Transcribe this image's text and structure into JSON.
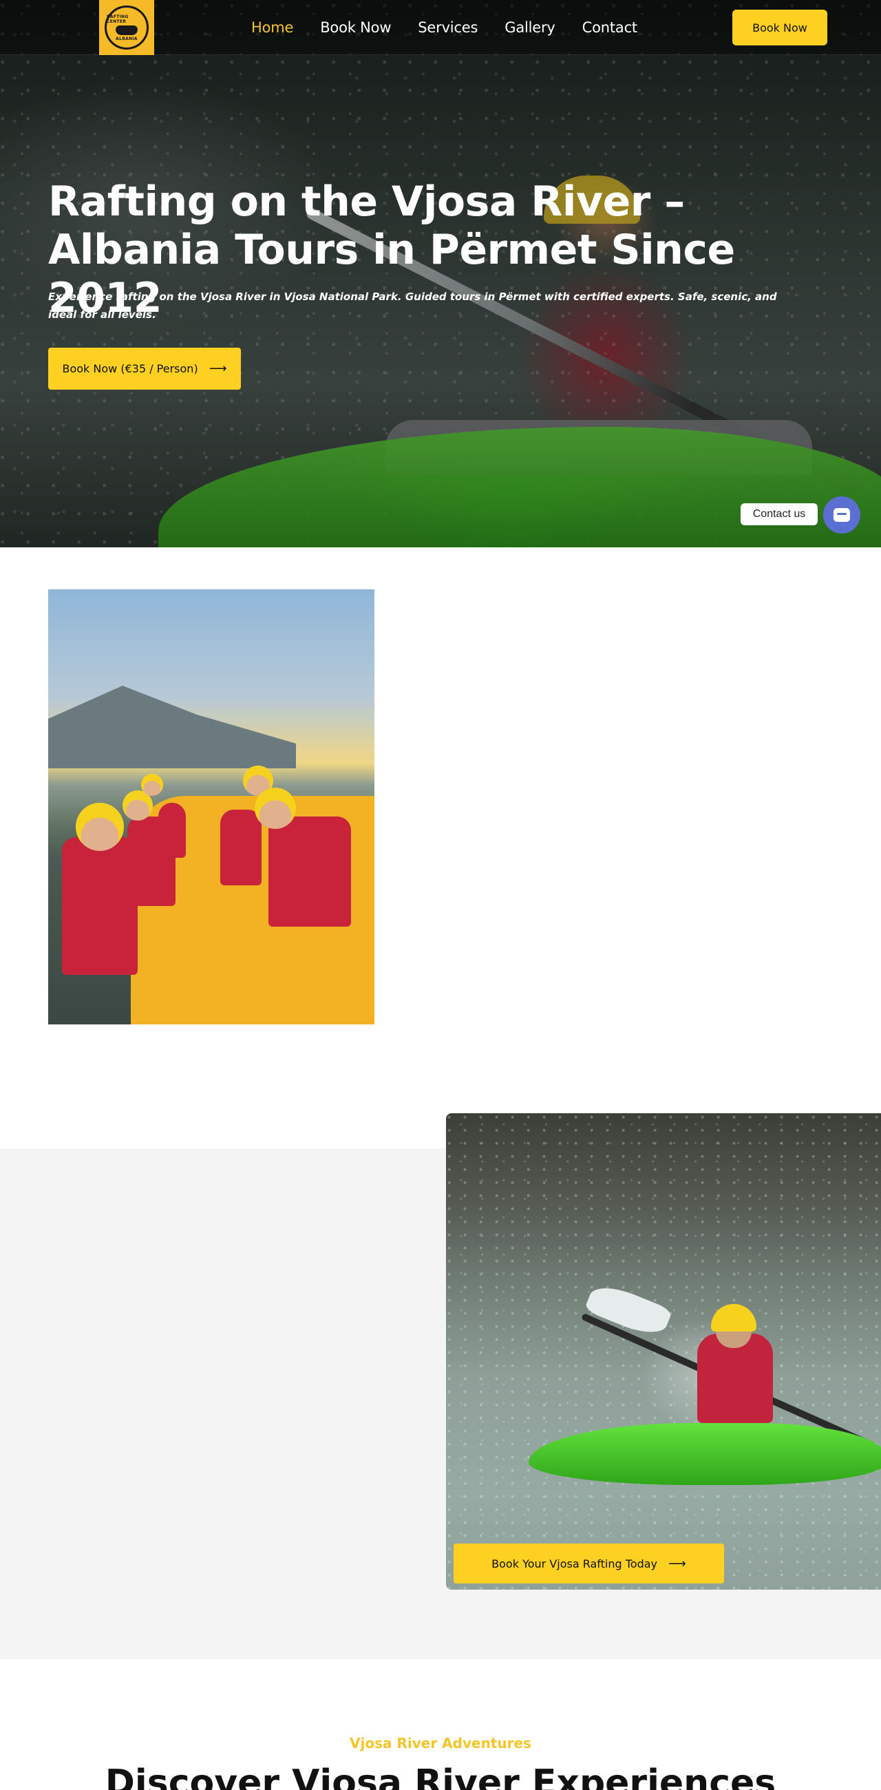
{
  "header": {
    "logo": {
      "top_text": "RAFTING CENTER",
      "bottom_text": "ALBANIA"
    },
    "nav": [
      {
        "label": "Home",
        "active": true
      },
      {
        "label": "Book Now",
        "active": false
      },
      {
        "label": "Services",
        "active": false
      },
      {
        "label": "Gallery",
        "active": false
      },
      {
        "label": "Contact",
        "active": false
      }
    ],
    "cta_label": "Book Now"
  },
  "hero": {
    "title_line1": "Rafting on the Vjosa River –",
    "title_line2": "Albania Tours in Përmet Since 2012",
    "subtitle": "Experience rafting on the Vjosa River in Vjosa National Park. Guided tours in Përmet with certified experts. Safe, scenic, and ideal for all levels.",
    "cta_label": "Book Now (€35 / Person)",
    "cta_icon": "arrow-right-icon"
  },
  "contact_widget": {
    "label": "Contact us",
    "icon": "chat-icon",
    "color": "#5a6fd1"
  },
  "kayak_section": {
    "cta_label": "Book Your Vjosa Rafting Today",
    "cta_icon": "arrow-right-icon"
  },
  "discover_section": {
    "eyebrow": "Vjosa River Adventures",
    "title": "Discover Vjosa River Experiences"
  },
  "colors": {
    "accent": "#fdd021",
    "active_nav": "#f6c629",
    "band_background": "#f4f4f4",
    "contact_widget": "#5a6fd1"
  }
}
